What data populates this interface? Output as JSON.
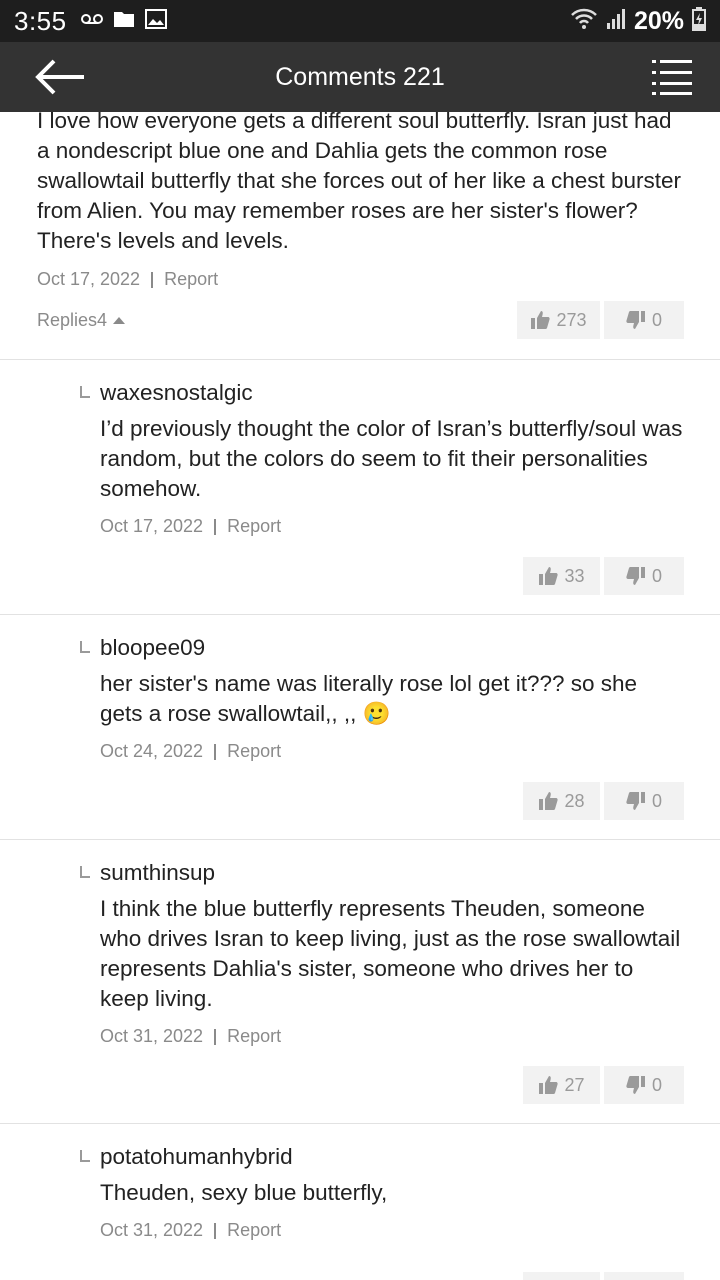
{
  "status_bar": {
    "time": "3:55",
    "battery": "20%",
    "icons": [
      "voicemail-icon",
      "folder-icon",
      "image-icon",
      "wifi-icon",
      "signal-icon",
      "battery-charging-icon"
    ]
  },
  "header": {
    "title": "Comments 221",
    "back_icon": "arrow-left-icon",
    "menu_icon": "list-icon"
  },
  "main_comment": {
    "text": "I love how everyone gets a different soul butterfly. Isran just had a nondescript blue one and Dahlia gets the common rose swallowtail butterfly that she forces out of her like a chest burster from Alien. You may remember roses are her sister's flower? There's levels and levels.",
    "date": "Oct 17, 2022",
    "report": "Report",
    "replies_label": "Replies",
    "replies_count": "4",
    "likes": "273",
    "dislikes": "0"
  },
  "replies": [
    {
      "user": "waxesnostalgic",
      "text": "I’d previously thought the color of Isran’s butterfly/soul was random, but the colors do seem to fit their personalities somehow.",
      "date": "Oct 17, 2022",
      "report": "Report",
      "likes": "33",
      "dislikes": "0"
    },
    {
      "user": "bloopee09",
      "text": "her sister's name was literally rose lol get it??? so she gets a rose swallowtail,, ,, 🥲",
      "date": "Oct 24, 2022",
      "report": "Report",
      "likes": "28",
      "dislikes": "0"
    },
    {
      "user": "sumthinsup",
      "text": "I think the blue butterfly represents Theuden, someone who drives Isran to keep living, just as the rose swallowtail represents Dahlia's sister, someone who drives her to keep living.",
      "date": "Oct 31, 2022",
      "report": "Report",
      "likes": "27",
      "dislikes": "0"
    },
    {
      "user": "potatohumanhybrid",
      "text": "Theuden, sexy blue butterfly,",
      "date": "Oct 31, 2022",
      "report": "Report",
      "likes": "",
      "dislikes": ""
    }
  ],
  "colors": {
    "status_bar_bg": "#1e1e1e",
    "app_bar_bg": "#333333",
    "meta_text": "#8a8a8a",
    "vote_bg": "#f2f2f2",
    "divider": "#e2e2e2"
  }
}
